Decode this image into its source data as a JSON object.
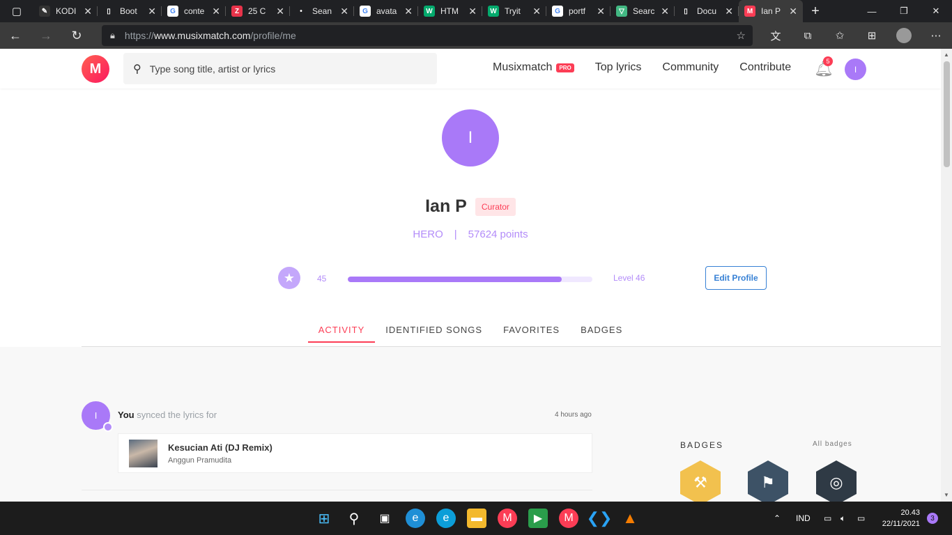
{
  "browser": {
    "tabs": [
      {
        "label": "KODI",
        "favicon": "pen-icon",
        "color": "#333333",
        "glyph": "✎"
      },
      {
        "label": "Boot",
        "favicon": "document-icon",
        "color": "#202124",
        "glyph": "▯"
      },
      {
        "label": "conte",
        "favicon": "google-icon",
        "color": "#ffffff",
        "glyph": "G"
      },
      {
        "label": "25 C",
        "favicon": "zety-icon",
        "color": "#e8334a",
        "glyph": "Z"
      },
      {
        "label": "Sean",
        "favicon": "dot-icon",
        "color": "#202124",
        "glyph": "•"
      },
      {
        "label": "avata",
        "favicon": "google-icon",
        "color": "#ffffff",
        "glyph": "G"
      },
      {
        "label": "HTM",
        "favicon": "w3-icon",
        "color": "#04aa6d",
        "glyph": "W"
      },
      {
        "label": "Tryit",
        "favicon": "w3-icon",
        "color": "#04aa6d",
        "glyph": "W"
      },
      {
        "label": "portf",
        "favicon": "google-icon",
        "color": "#ffffff",
        "glyph": "G"
      },
      {
        "label": "Searc",
        "favicon": "vue-icon",
        "color": "#42b883",
        "glyph": "▽"
      },
      {
        "label": "Docu",
        "favicon": "document-icon",
        "color": "#202124",
        "glyph": "▯"
      },
      {
        "label": "Ian P",
        "favicon": "musixmatch-icon",
        "color": "#fc3d55",
        "glyph": "M"
      }
    ],
    "url_prefix": "https://",
    "url_domain": "www.musixmatch.com",
    "url_path": "/profile/me"
  },
  "header": {
    "logo": "M",
    "search_placeholder": "Type song title, artist or lyrics",
    "nav": {
      "musixmatch": "Musixmatch",
      "pro": "PRO",
      "top_lyrics": "Top lyrics",
      "community": "Community",
      "contribute": "Contribute"
    },
    "notification_count": "5",
    "avatar_initial": "I"
  },
  "profile": {
    "initial": "I",
    "name": "Ian P",
    "role": "Curator",
    "rank": "HERO",
    "separator": "|",
    "points": "57624 points",
    "level_current": "45",
    "level_next": "Level 46",
    "level_progress": 0.876,
    "edit_label": "Edit Profile"
  },
  "tabs": {
    "activity": "ACTIVITY",
    "identified": "IDENTIFIED SONGS",
    "favorites": "FAVORITES",
    "badges": "BADGES"
  },
  "activity": {
    "avatar_initial": "I",
    "actor": "You",
    "action": " synced the lyrics for",
    "time": "4 hours ago",
    "song_title": "Kesucian Ati (DJ Remix)",
    "song_artist": "Anggun Pramudita"
  },
  "badges": {
    "title": "BADGES",
    "all_link": "All badges",
    "items": [
      {
        "icon": "gavel-badge-icon",
        "color": "#f2c14e",
        "glyph": "⚒"
      },
      {
        "icon": "moon-flag-badge-icon",
        "color": "#3d5266",
        "glyph": "⚑"
      },
      {
        "icon": "medal-badge-icon",
        "color": "#2f3a45",
        "glyph": "◎"
      },
      {
        "icon": "star-badge-icon",
        "color": "#a979f8",
        "glyph": "★"
      },
      {
        "icon": "typewriter-badge-icon",
        "color": "#2fb4c8",
        "glyph": "⌨"
      },
      {
        "icon": "quill-badge-icon",
        "color": "#4a90e2",
        "glyph": "✒"
      }
    ]
  },
  "taskbar": {
    "language": "IND",
    "time": "20.43",
    "date": "22/11/2021",
    "notifications": "3"
  }
}
